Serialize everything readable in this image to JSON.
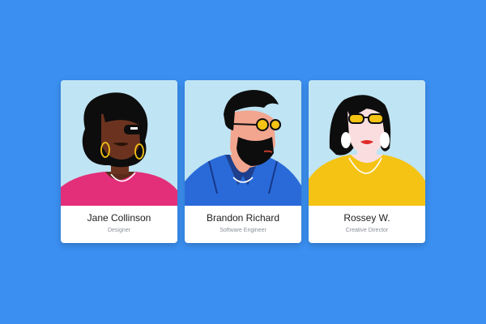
{
  "colors": {
    "background": "#3a8ff0",
    "card": "#ffffff",
    "portrait_bg": "#bfe4f3"
  },
  "cards": [
    {
      "name": "Jane Collinson",
      "role": "Designer",
      "shirt_color": "#e32f7a"
    },
    {
      "name": "Brandon Richard",
      "role": "Software Engineer",
      "shirt_color": "#2a6ad8"
    },
    {
      "name": "Rossey W.",
      "role": "Creative Director",
      "shirt_color": "#f4c314"
    }
  ]
}
